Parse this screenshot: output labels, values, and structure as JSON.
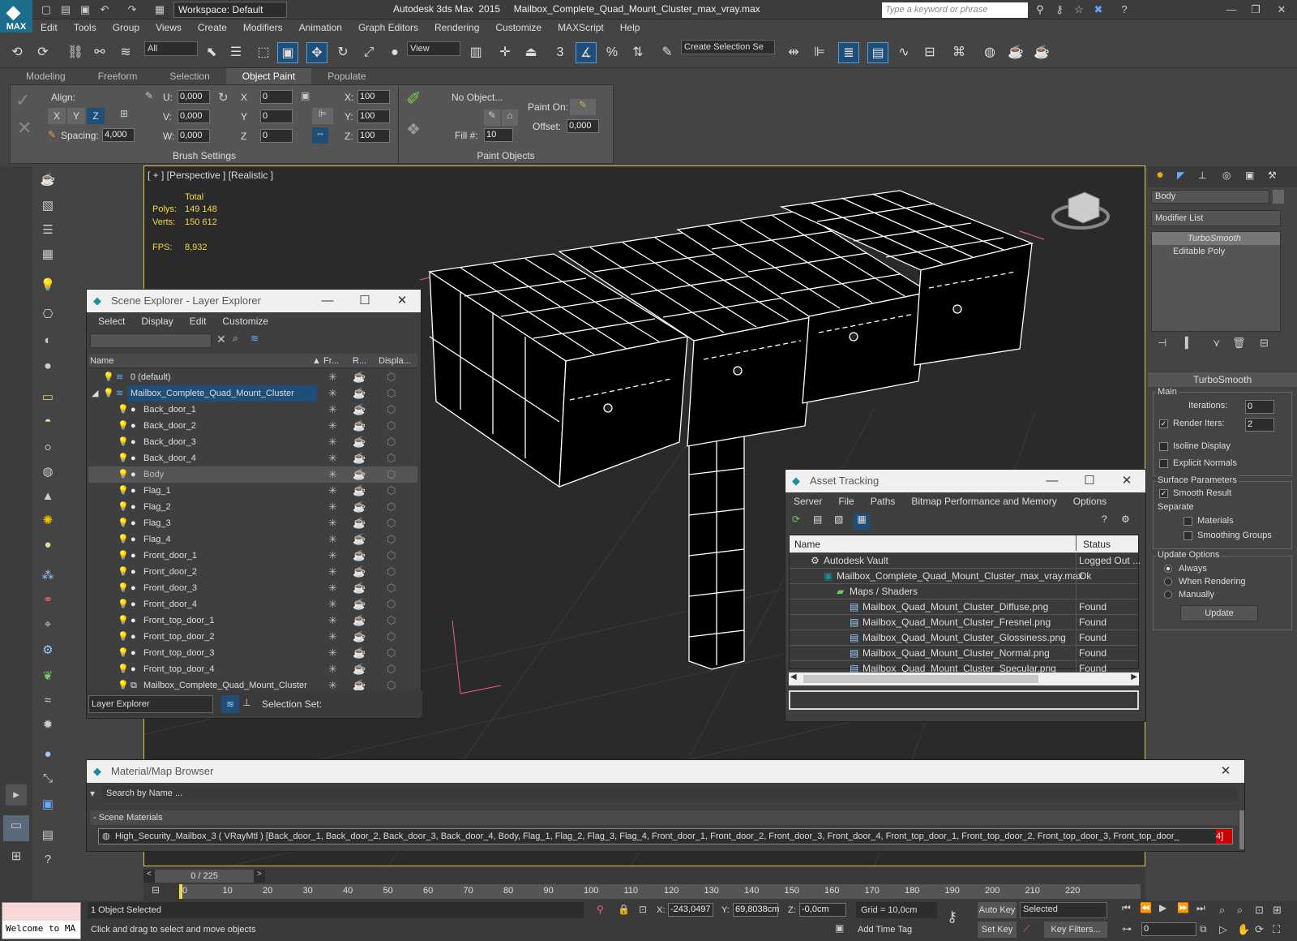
{
  "app": {
    "logo": "MAX",
    "workspace": "Workspace: Default",
    "title": "Autodesk 3ds Max  2015     Mailbox_Complete_Quad_Mount_Cluster_max_vray.max",
    "search_placeholder": "Type a keyword or phrase"
  },
  "menu": [
    "Edit",
    "Tools",
    "Group",
    "Views",
    "Create",
    "Modifiers",
    "Animation",
    "Graph Editors",
    "Rendering",
    "Customize",
    "MAXScript",
    "Help"
  ],
  "toolbar": {
    "filter": "All",
    "refcoord": "View",
    "snap_label": "3",
    "selset": "Create Selection Se"
  },
  "ribbon": {
    "tabs": [
      "Modeling",
      "Freeform",
      "Selection",
      "Object Paint",
      "Populate"
    ],
    "active": "Object Paint",
    "align": "Align:",
    "x": "X",
    "y": "Y",
    "z": "Z",
    "spacing_label": "Spacing:",
    "spacing": "4,000",
    "u_label": "U:",
    "u": "0,000",
    "v_label": "V:",
    "v": "0,000",
    "w_label": "W:",
    "w": "0,000",
    "rx": "0",
    "ry": "0",
    "rz": "0",
    "sx": "100",
    "sy": "100",
    "sz": "100",
    "noobj": "No Object...",
    "fill_label": "Fill #:",
    "fill": "10",
    "paint_on": "Paint On:",
    "offset_label": "Offset:",
    "offset": "0,000",
    "brush_settings": "Brush Settings",
    "paint_objects": "Paint Objects"
  },
  "viewport": {
    "label": "[ + ] [Perspective ] [Realistic ]",
    "total": "Total",
    "polys_label": "Polys:",
    "polys": "149 148",
    "verts_label": "Verts:",
    "verts": "150 612",
    "fps_label": "FPS:",
    "fps": "8,932"
  },
  "scene_explorer": {
    "title": "Scene Explorer - Layer Explorer",
    "menu": [
      "Select",
      "Display",
      "Edit",
      "Customize"
    ],
    "cols": [
      "Name",
      "Fr...",
      "R...",
      "Displa..."
    ],
    "layer_default": "0 (default)",
    "layer_cluster": "Mailbox_Complete_Quad_Mount_Cluster",
    "items": [
      "Back_door_1",
      "Back_door_2",
      "Back_door_3",
      "Back_door_4",
      "Body",
      "Flag_1",
      "Flag_2",
      "Flag_3",
      "Flag_4",
      "Front_door_1",
      "Front_door_2",
      "Front_door_3",
      "Front_door_4",
      "Front_top_door_1",
      "Front_top_door_2",
      "Front_top_door_3",
      "Front_top_door_4",
      "Mailbox_Complete_Quad_Mount_Cluster"
    ],
    "footer": "Layer Explorer",
    "selset": "Selection Set:"
  },
  "asset_tracking": {
    "title": "Asset Tracking",
    "menu": [
      "Server",
      "File",
      "Paths",
      "Bitmap Performance and Memory",
      "Options"
    ],
    "cols": [
      "Name",
      "Status"
    ],
    "rows": [
      {
        "name": "Autodesk Vault",
        "status": "Logged Out ..."
      },
      {
        "name": "Mailbox_Complete_Quad_Mount_Cluster_max_vray.max",
        "status": "Ok"
      },
      {
        "name": "Maps / Shaders",
        "status": ""
      },
      {
        "name": "Mailbox_Quad_Mount_Cluster_Diffuse.png",
        "status": "Found"
      },
      {
        "name": "Mailbox_Quad_Mount_Cluster_Fresnel.png",
        "status": "Found"
      },
      {
        "name": "Mailbox_Quad_Mount_Cluster_Glossiness.png",
        "status": "Found"
      },
      {
        "name": "Mailbox_Quad_Mount_Cluster_Normal.png",
        "status": "Found"
      },
      {
        "name": "Mailbox_Quad_Mount_Cluster_Specular.png",
        "status": "Found"
      }
    ]
  },
  "material_browser": {
    "title": "Material/Map Browser",
    "search": "Search by Name ...",
    "section": "- Scene Materials",
    "material": "High_Security_Mailbox_3  ( VRayMtl ) [Back_door_1, Back_door_2, Back_door_3, Back_door_4, Body, Flag_1, Flag_2, Flag_3, Flag_4, Front_door_1, Front_door_2, Front_door_3, Front_door_4, Front_top_door_1, Front_top_door_2, Front_top_door_3, Front_top_door_",
    "material_end": "4]"
  },
  "command_panel": {
    "object_name": "Body",
    "modifier_list": "Modifier List",
    "stack": [
      "TurboSmooth",
      "Editable Poly"
    ],
    "rollout": "TurboSmooth",
    "main": "Main",
    "iterations_label": "Iterations:",
    "iterations": "0",
    "render_iters_label": "Render Iters:",
    "render_iters": "2",
    "isoline": "Isoline Display",
    "explicit": "Explicit Normals",
    "surface": "Surface Parameters",
    "smooth_result": "Smooth Result",
    "separate": "Separate",
    "materials": "Materials",
    "smoothing_groups": "Smoothing Groups",
    "update_options": "Update Options",
    "always": "Always",
    "when_rendering": "When Rendering",
    "manually": "Manually",
    "update": "Update"
  },
  "timeline": {
    "frame": "0 / 225",
    "ticks": [
      "0",
      "10",
      "20",
      "30",
      "40",
      "50",
      "60",
      "70",
      "80",
      "90",
      "100",
      "110",
      "120",
      "130",
      "140",
      "150",
      "160",
      "170",
      "180",
      "190",
      "200",
      "210",
      "220"
    ]
  },
  "status": {
    "listener": "Welcome to MA",
    "selected": "1 Object Selected",
    "prompt": "Click and drag to select and move objects",
    "x_label": "X:",
    "x": "-243,0497",
    "y_label": "Y:",
    "y": "69,8038cm",
    "z_label": "Z:",
    "z": "-0,0cm",
    "grid": "Grid = 10,0cm",
    "add_time_tag": "Add Time Tag",
    "auto_key": "Auto Key",
    "set_key": "Set Key",
    "key_mode": "Selected",
    "key_filters": "Key Filters...",
    "frame": "0"
  }
}
